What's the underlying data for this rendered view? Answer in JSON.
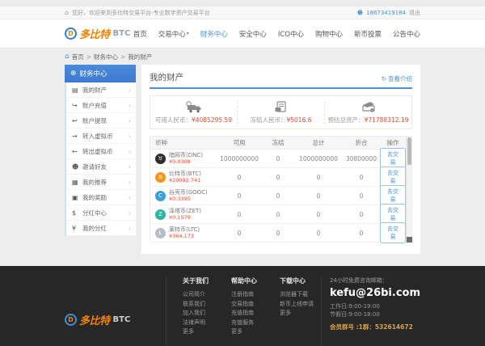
{
  "colors": {
    "accent_blue": "#4a90d9",
    "value_red": "#f0482f",
    "logo_orange": "#f08200",
    "footer_bg": "#272727",
    "group_gold": "#d8a345"
  },
  "topbar": {
    "home_glyph": "⌂",
    "welcome": "您好，欢迎来到多比特交易平台-专业数字资产交易平台",
    "user_glyph": "☻",
    "phone": "18673419184",
    "logout": "退出"
  },
  "header": {
    "logo_badge": "D",
    "logo_main": "多比特",
    "logo_sub": "BTC",
    "caret_glyph": "▾",
    "nav": [
      {
        "label": "首页"
      },
      {
        "label": "交易中心"
      },
      {
        "label": "财务中心"
      },
      {
        "label": "安全中心"
      },
      {
        "label": "ICO中心"
      },
      {
        "label": "购物中心"
      },
      {
        "label": "新币投票"
      },
      {
        "label": "公告中心"
      }
    ]
  },
  "breadcrumb": {
    "home_glyph": "⌂",
    "items": [
      "首页",
      "财务中心",
      "我的财产"
    ],
    "separator": ">"
  },
  "sidebar": {
    "title": "财务中心",
    "title_glyph": "⊕",
    "chevron": "›",
    "items": [
      {
        "glyph": "▤",
        "label": "我的财产"
      },
      {
        "glyph": "↪",
        "label": "账户充值"
      },
      {
        "glyph": "↩",
        "label": "账户提现"
      },
      {
        "glyph": "→",
        "label": "转入虚拟币"
      },
      {
        "glyph": "←",
        "label": "转出虚拟币"
      },
      {
        "glyph": "☻",
        "label": "邀请好友"
      },
      {
        "glyph": "▦",
        "label": "我的推荐"
      },
      {
        "glyph": "▣",
        "label": "我的奖励"
      },
      {
        "glyph": "$",
        "label": "分红中心"
      },
      {
        "glyph": "¥",
        "label": "我的分红"
      }
    ]
  },
  "main": {
    "title": "我的财产",
    "view_link": "查看介绍",
    "view_glyph": "↻",
    "stats": [
      {
        "label": "可用人民币：",
        "value": "¥4085295.59"
      },
      {
        "label": "冻结人民币：",
        "value": "¥5016.6"
      },
      {
        "label": "预估总资产：",
        "value": "¥71788312.19"
      }
    ],
    "table": {
      "headers": [
        "币种",
        "可用",
        "冻结",
        "总计",
        "折合",
        "操作"
      ],
      "action_label": "去交易",
      "rows": [
        {
          "name": "暗网币(DNC)",
          "price": "¥0.0308",
          "symbol": "♉",
          "icon_color": "#2e2e2e",
          "available": "1000000000",
          "frozen": "0",
          "total": "1000000000",
          "converted": "30800000"
        },
        {
          "name": "比特币(BTC)",
          "price": "¥29092.741",
          "symbol": "B",
          "icon_color": "#f7931a",
          "available": "0",
          "frozen": "0",
          "total": "0",
          "converted": "0"
        },
        {
          "name": "谷壳币(GOOC)",
          "price": "¥0.3395",
          "symbol": "C",
          "icon_color": "#3b9fd8",
          "available": "0",
          "frozen": "0",
          "total": "0",
          "converted": "0"
        },
        {
          "name": "泽塔币(ZET)",
          "price": "¥0.1579",
          "symbol": "Z",
          "icon_color": "#2bb3a3",
          "available": "0",
          "frozen": "0",
          "total": "0",
          "converted": "0"
        },
        {
          "name": "莱特币(LTC)",
          "price": "¥364.173",
          "symbol": "Ł",
          "icon_color": "#b4bcc4",
          "available": "0",
          "frozen": "0",
          "total": "0",
          "converted": "0"
        }
      ]
    }
  },
  "footer": {
    "logo_badge": "D",
    "logo_main": "多比特",
    "logo_sub": "BTC",
    "columns": [
      {
        "title": "关于我们",
        "links": [
          "公司简介",
          "联系我们",
          "加入我们",
          "法律声明",
          "更多"
        ]
      },
      {
        "title": "帮助中心",
        "links": [
          "注册指南",
          "交易指南",
          "充值指南",
          "充值服务",
          "更多"
        ]
      },
      {
        "title": "下载中心",
        "links": [
          "浏览器下载",
          "新币上线申请",
          "更多"
        ]
      }
    ],
    "contact": {
      "label": "24小时免费咨询邮箱：",
      "email": "kefu@26bi.com",
      "hours_weekday": "工作日:9:00-19:00",
      "hours_holiday": "节假日:9:00-18:00",
      "group": "会员群号 :1群：532614672"
    }
  }
}
